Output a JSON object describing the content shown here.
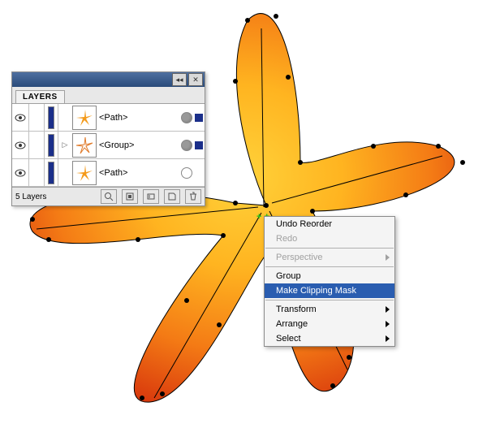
{
  "layers_panel": {
    "tab_label": "LAYERS",
    "footer_text": "5 Layers",
    "rows": [
      {
        "name": "<Path>",
        "expand": "",
        "target_filled": true,
        "selected": true
      },
      {
        "name": "<Group>",
        "expand": "▷",
        "target_filled": true,
        "selected": true
      },
      {
        "name": "<Path>",
        "expand": "",
        "target_filled": false,
        "selected": false
      }
    ]
  },
  "context_menu": {
    "items": [
      {
        "label": "Undo Reorder",
        "type": "item"
      },
      {
        "label": "Redo",
        "type": "item",
        "disabled": true
      },
      {
        "type": "sep"
      },
      {
        "label": "Perspective",
        "type": "submenu",
        "disabled": true
      },
      {
        "type": "sep"
      },
      {
        "label": "Group",
        "type": "item"
      },
      {
        "label": "Make Clipping Mask",
        "type": "item",
        "selected": true
      },
      {
        "type": "sep"
      },
      {
        "label": "Transform",
        "type": "submenu"
      },
      {
        "label": "Arrange",
        "type": "submenu"
      },
      {
        "label": "Select",
        "type": "submenu"
      }
    ]
  },
  "icon_labels": {
    "collapse": "◂◂",
    "close": "✕"
  }
}
